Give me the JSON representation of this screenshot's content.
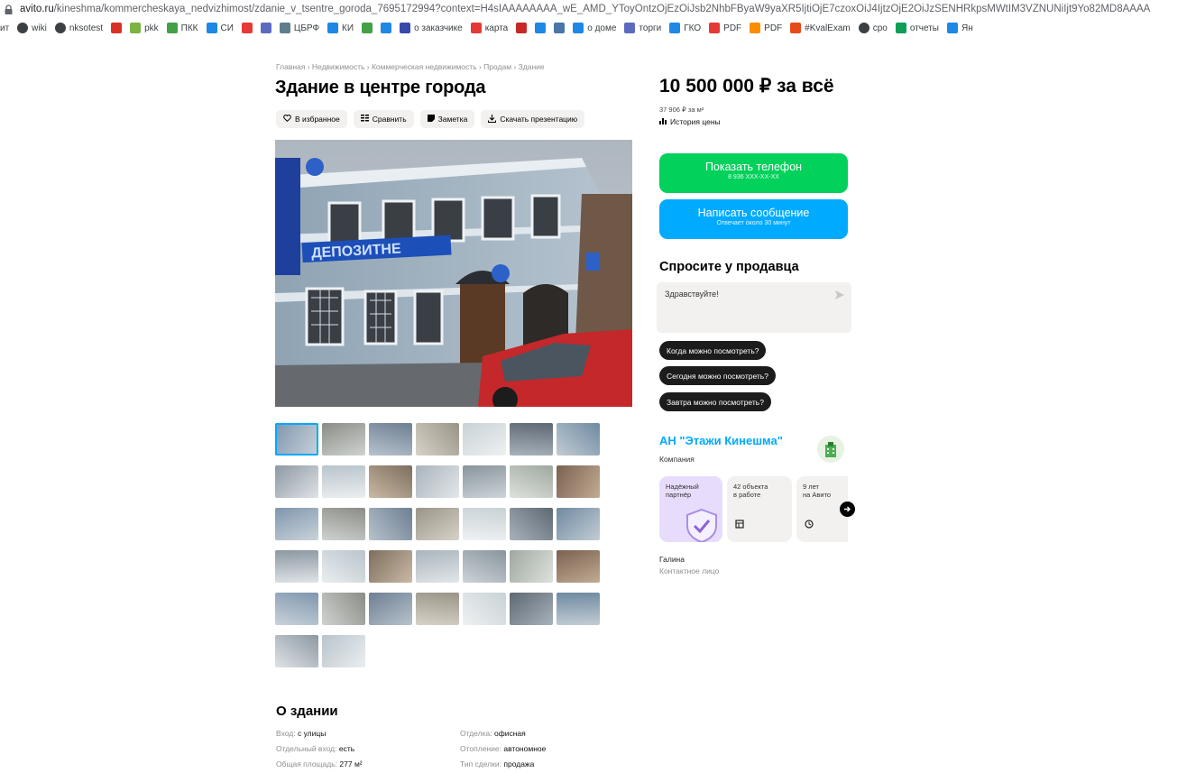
{
  "browser": {
    "url_host": "avito.ru",
    "url_path": "/kineshma/kommercheskaya_nedvizhimost/zdanie_v_tsentre_goroda_7695172994?context=H4sIAAAAAAAA_wE_AMD_YToyOntzOjEzOiJsb2NhbFByaW9yaXR5IjtiOjE7czoxOiJ4IjtzOjE2OiJzSENHRkpsMWtIM3VZNUNiIjt9Yo82MD8AAAA",
    "bookmarks": [
      {
        "label": "ит",
        "icon": "none"
      },
      {
        "label": "wiki",
        "icon": "globe-icon"
      },
      {
        "label": "nksotest",
        "icon": "globe-icon"
      },
      {
        "label": "",
        "icon": "red-square-icon",
        "color": "#d93025"
      },
      {
        "label": "pkk",
        "icon": "leaf-icon",
        "color": "#7cb342"
      },
      {
        "label": "ПКК",
        "icon": "leaf-icon",
        "color": "#43a047"
      },
      {
        "label": "СИ",
        "icon": "map-icon",
        "color": "#1e88e5"
      },
      {
        "label": "",
        "icon": "star-icon",
        "color": "#e53935"
      },
      {
        "label": "",
        "icon": "emblem-icon",
        "color": "#5c6bc0"
      },
      {
        "label": "ЦБРФ",
        "icon": "bank-icon",
        "color": "#607d8b"
      },
      {
        "label": "КИ",
        "icon": "chart-icon",
        "color": "#1e88e5"
      },
      {
        "label": "",
        "icon": "dots-icon",
        "color": "#43a047"
      },
      {
        "label": "",
        "icon": "check-icon",
        "color": "#1e88e5"
      },
      {
        "label": "о заказчике",
        "icon": "circle-icon",
        "color": "#3949ab"
      },
      {
        "label": "карта",
        "icon": "pin-icon",
        "color": "#e53935"
      },
      {
        "label": "",
        "icon": "hat-icon",
        "color": "#c62828"
      },
      {
        "label": "",
        "icon": "pencil-icon",
        "color": "#1e88e5"
      },
      {
        "label": "",
        "icon": "vk-icon",
        "color": "#4a76a8"
      },
      {
        "label": "о доме",
        "icon": "house-icon",
        "color": "#1e88e5"
      },
      {
        "label": "торги",
        "icon": "emblem-icon",
        "color": "#5c6bc0"
      },
      {
        "label": "ГКО",
        "icon": "map-icon",
        "color": "#1e88e5"
      },
      {
        "label": "PDF",
        "icon": "heart-icon",
        "color": "#e53935"
      },
      {
        "label": "PDF",
        "icon": "colorful-icon",
        "color": "#fb8c00"
      },
      {
        "label": "#KvalExam",
        "icon": "mail-icon",
        "color": "#e64a19"
      },
      {
        "label": "сро",
        "icon": "globe-icon"
      },
      {
        "label": "отчеты",
        "icon": "sheet-icon",
        "color": "#0f9d58"
      },
      {
        "label": "Ян",
        "icon": "bird-icon",
        "color": "#1e88e5"
      }
    ]
  },
  "listing": {
    "breadcrumbs": "Главная › Недвижимость › Коммерческая недвижимость › Продам › Здание",
    "title": "Здание в центре города",
    "actions": {
      "favorite": "В избранное",
      "compare": "Сравнить",
      "note": "Заметка",
      "download": "Скачать презентацию"
    },
    "thumbnail_count": 37,
    "active_thumbnail": 1
  },
  "sidebar": {
    "price": "10 500 000 ₽ за всё",
    "price_per_m": "37 906 ₽ за м²",
    "price_history": "История цены",
    "show_phone": "Показать телефон",
    "phone_masked": "8 936 XXX-XX-XX",
    "write_message": "Написать сообщение",
    "reply_time": "Отвечает около 30 минут",
    "ask_title": "Спросите у продавца",
    "ask_text": "Здравствуйте!",
    "quick_questions": [
      "Когда можно посмотреть?",
      "Сегодня можно посмотреть?",
      "Завтра можно посмотреть?"
    ],
    "seller_name": "АН \"Этажи Кинешма\"",
    "seller_type": "Компания",
    "badges": [
      {
        "l1": "Надёжный",
        "l2": "партнёр"
      },
      {
        "l1": "42 объекта",
        "l2": "в работе"
      },
      {
        "l1": "9 лет",
        "l2": "на Авито"
      }
    ],
    "contact_name": "Галина",
    "contact_role": "Контактное лицо"
  },
  "about": {
    "title": "О здании",
    "params": [
      {
        "k": "Вход:",
        "v": "с улицы"
      },
      {
        "k": "Отдельный вход:",
        "v": "есть"
      },
      {
        "k": "Общая площадь:",
        "v": "277 м²"
      },
      {
        "k": "Отделка:",
        "v": "офисная"
      },
      {
        "k": "Отопление:",
        "v": "автономное"
      },
      {
        "k": "Тип сделки:",
        "v": "продажа"
      }
    ]
  }
}
